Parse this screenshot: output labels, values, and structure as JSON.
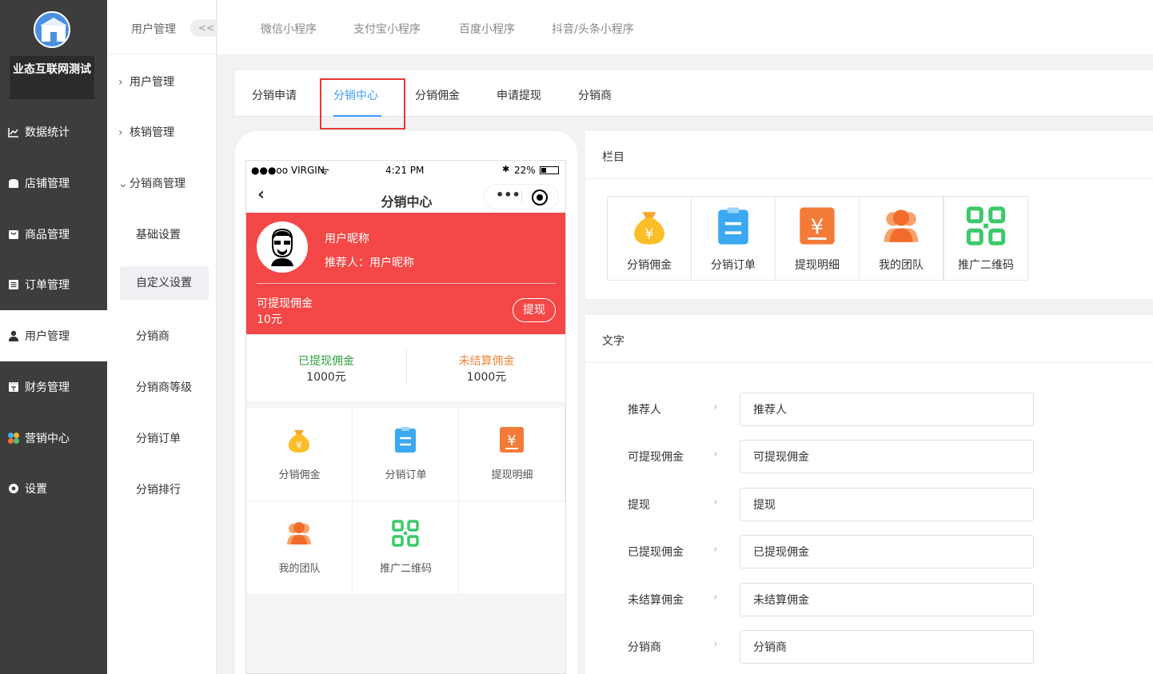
{
  "sidebar": {
    "store_name": "业态互联网测试",
    "items": [
      {
        "label": "数据统计",
        "icon": "chart-icon"
      },
      {
        "label": "店铺管理",
        "icon": "shop-icon"
      },
      {
        "label": "商品管理",
        "icon": "goods-icon"
      },
      {
        "label": "订单管理",
        "icon": "order-icon"
      },
      {
        "label": "用户管理",
        "icon": "user-icon",
        "active": true
      },
      {
        "label": "财务管理",
        "icon": "finance-icon"
      },
      {
        "label": "营销中心",
        "icon": "marketing-icon"
      },
      {
        "label": "设置",
        "icon": "settings-icon"
      }
    ]
  },
  "subnav": {
    "title": "用户管理",
    "collapse_label": "<<",
    "groups": [
      {
        "label": "用户管理"
      },
      {
        "label": "核销管理"
      },
      {
        "label": "分销商管理"
      }
    ],
    "children": [
      "基础设置",
      "自定义设置",
      "分销商",
      "分销商等级",
      "分销订单",
      "分销排行"
    ]
  },
  "topbar": {
    "tabs": [
      "微信小程序",
      "支付宝小程序",
      "百度小程序",
      "抖音/头条小程序"
    ]
  },
  "content_tabs": [
    "分销申请",
    "分销中心",
    "分销佣金",
    "申请提现",
    "分销商"
  ],
  "phone": {
    "carrier": "●●●oo VIRGIN",
    "time": "4:21 PM",
    "battery": "22%",
    "page_title": "分销中心",
    "nickname": "用户昵称",
    "referrer": "推荐人：用户昵称",
    "withdrawable_label": "可提现佣金",
    "withdrawable_value": "10元",
    "withdraw_button": "提现",
    "withdrawn_label": "已提现佣金",
    "withdrawn_value": "1000元",
    "unsettled_label": "未结算佣金",
    "unsettled_value": "1000元",
    "grid": [
      "分销佣金",
      "分销订单",
      "提现明细",
      "我的团队",
      "推广二维码"
    ]
  },
  "columns_panel": {
    "title": "栏目",
    "items": [
      "分销佣金",
      "分销订单",
      "提现明细",
      "我的团队",
      "推广二维码"
    ]
  },
  "text_panel": {
    "title": "文字",
    "fields": [
      {
        "label": "推荐人",
        "value": "推荐人"
      },
      {
        "label": "可提现佣金",
        "value": "可提现佣金"
      },
      {
        "label": "提现",
        "value": "提现"
      },
      {
        "label": "已提现佣金",
        "value": "已提现佣金"
      },
      {
        "label": "未结算佣金",
        "value": "未结算佣金"
      },
      {
        "label": "分销商",
        "value": "分销商"
      }
    ]
  },
  "colors": {
    "accent": "#409eff",
    "card_red": "#f44747",
    "sidebar": "#3d3d3d",
    "withdrawn_green": "#2e9e3a",
    "unsettled_orange": "#f0883a"
  }
}
